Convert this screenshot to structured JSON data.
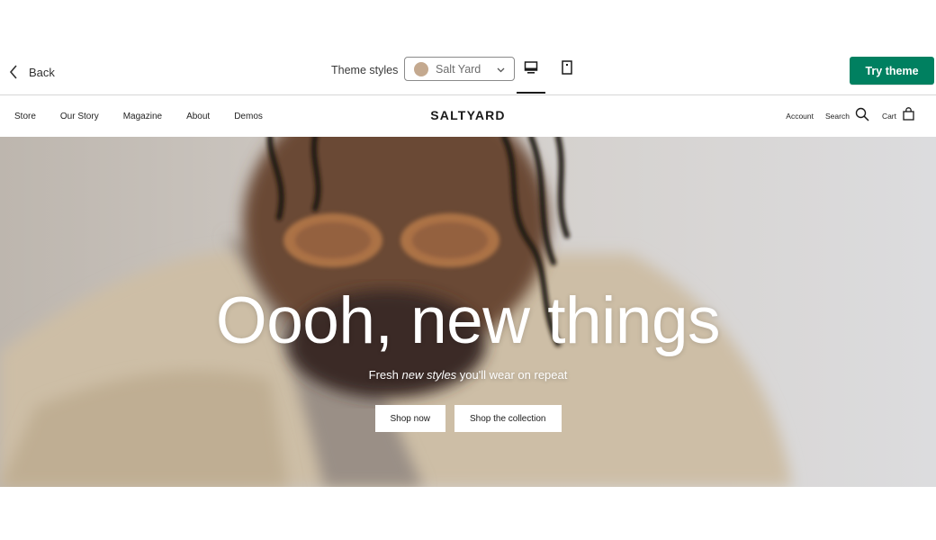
{
  "toolbar": {
    "back_label": "Back",
    "theme_styles_label": "Theme styles",
    "selected_style": "Salt Yard",
    "swatch_color": "#c4a98f",
    "try_theme_label": "Try theme",
    "accent_color": "#008060"
  },
  "store": {
    "nav": [
      "Store",
      "Our Story",
      "Magazine",
      "About",
      "Demos"
    ],
    "logo": "SALTYARD",
    "account_label": "Account",
    "search_label": "Search",
    "cart_label": "Cart"
  },
  "hero": {
    "title": "Oooh, new things",
    "subtitle_before": "Fresh ",
    "subtitle_em": "new styles",
    "subtitle_after": " you'll wear on repeat",
    "buttons": [
      "Shop now",
      "Shop the collection"
    ]
  },
  "icons": {
    "back": "chevron-left-icon",
    "dropdown": "chevron-down-icon",
    "desktop": "desktop-icon",
    "mobile": "mobile-icon",
    "search": "search-icon",
    "cart": "shopping-bag-icon"
  }
}
